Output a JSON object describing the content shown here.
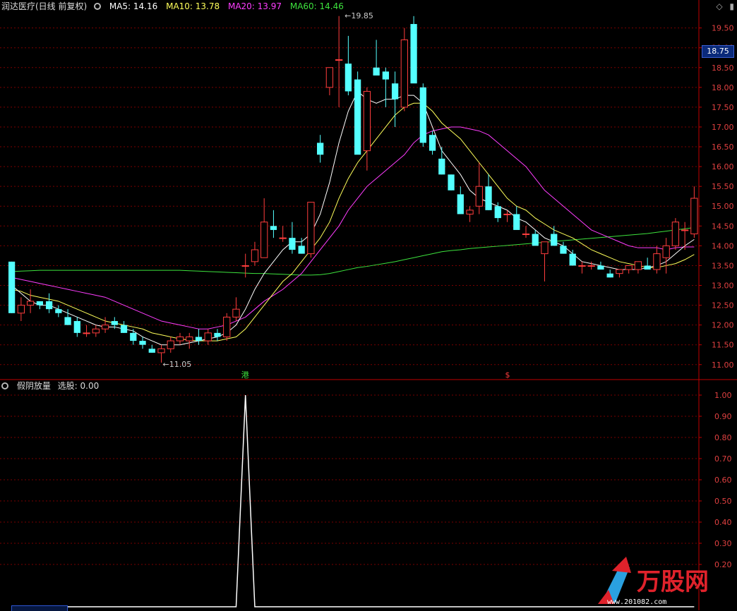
{
  "header_top": {
    "title": "润达医疗(日线 前复权)",
    "ma5": "MA5: 14.16",
    "ma10": "MA10: 13.78",
    "ma20": "MA20: 13.97",
    "ma60": "MA60: 14.46"
  },
  "header_bottom": {
    "title": "假阴放量",
    "value": "选股: 0.00"
  },
  "current_price_tag": "18.75",
  "annotations": {
    "high": "19.85",
    "low": "11.05",
    "marker_a": "港",
    "marker_b": "$"
  },
  "watermark": {
    "brand": "万股网",
    "url": "www.201082.com"
  },
  "colors": {
    "up": "#ff3d3d",
    "down": "#54ffff",
    "ma5": "#ffffff",
    "ma10": "#ffff5a",
    "ma20": "#ff3dff",
    "ma60": "#3de23d",
    "grid": "#7a0000",
    "axis": "#c00000"
  },
  "chart_data": [
    {
      "type": "candlestick",
      "title": "润达医疗(日线 前复权)",
      "ylim": [
        10.8,
        19.85
      ],
      "yticks": [
        "11.00",
        "11.50",
        "12.00",
        "12.50",
        "13.00",
        "13.50",
        "14.00",
        "14.50",
        "15.00",
        "15.50",
        "16.00",
        "16.50",
        "17.00",
        "17.50",
        "18.00",
        "18.50",
        "19.00",
        "19.50"
      ],
      "candles": [
        [
          13.6,
          13.6,
          12.3,
          12.3
        ],
        [
          12.3,
          12.7,
          12.1,
          12.5
        ],
        [
          12.5,
          12.9,
          12.3,
          12.6
        ],
        [
          12.6,
          12.6,
          12.4,
          12.5
        ],
        [
          12.6,
          12.8,
          12.3,
          12.4
        ],
        [
          12.4,
          12.5,
          12.2,
          12.3
        ],
        [
          12.2,
          12.4,
          12.0,
          12.0
        ],
        [
          12.1,
          12.2,
          11.7,
          11.8
        ],
        [
          11.8,
          12.0,
          11.7,
          11.8
        ],
        [
          11.8,
          12.0,
          11.7,
          11.9
        ],
        [
          11.9,
          12.2,
          11.8,
          12.0
        ],
        [
          12.1,
          12.2,
          11.9,
          12.0
        ],
        [
          12.0,
          12.1,
          11.8,
          11.8
        ],
        [
          11.8,
          11.9,
          11.5,
          11.6
        ],
        [
          11.6,
          11.7,
          11.4,
          11.5
        ],
        [
          11.4,
          11.5,
          11.3,
          11.3
        ],
        [
          11.3,
          11.5,
          11.05,
          11.4
        ],
        [
          11.4,
          11.7,
          11.3,
          11.6
        ],
        [
          11.6,
          11.8,
          11.5,
          11.7
        ],
        [
          11.6,
          11.8,
          11.4,
          11.7
        ],
        [
          11.7,
          11.9,
          11.5,
          11.6
        ],
        [
          11.6,
          11.9,
          11.5,
          11.8
        ],
        [
          11.8,
          11.9,
          11.6,
          11.7
        ],
        [
          11.7,
          12.3,
          11.6,
          12.2
        ],
        [
          12.2,
          12.7,
          12.1,
          12.4
        ],
        [
          13.5,
          13.8,
          13.2,
          13.5
        ],
        [
          13.6,
          14.1,
          13.5,
          13.9
        ],
        [
          13.7,
          15.2,
          13.7,
          14.6
        ],
        [
          14.5,
          14.9,
          14.2,
          14.4
        ],
        [
          14.2,
          14.5,
          14.1,
          14.2
        ],
        [
          14.2,
          14.6,
          13.8,
          13.9
        ],
        [
          14.0,
          14.2,
          13.8,
          13.8
        ],
        [
          13.8,
          15.0,
          13.7,
          15.1
        ],
        [
          16.6,
          16.8,
          16.1,
          16.3
        ],
        [
          18.0,
          18.5,
          17.8,
          18.5
        ],
        [
          18.7,
          19.8,
          17.5,
          18.7
        ],
        [
          18.6,
          19.3,
          17.8,
          17.9
        ],
        [
          18.2,
          18.4,
          16.8,
          16.3
        ],
        [
          16.4,
          18.0,
          15.9,
          17.9
        ],
        [
          18.5,
          19.2,
          18.3,
          18.3
        ],
        [
          18.4,
          18.5,
          17.5,
          18.2
        ],
        [
          18.1,
          18.4,
          17.0,
          17.7
        ],
        [
          17.5,
          19.5,
          17.4,
          19.2
        ],
        [
          19.6,
          19.8,
          18.2,
          18.1
        ],
        [
          18.0,
          18.1,
          16.5,
          16.6
        ],
        [
          16.8,
          16.9,
          16.3,
          16.4
        ],
        [
          16.2,
          16.5,
          15.8,
          15.8
        ],
        [
          15.8,
          15.8,
          15.4,
          15.4
        ],
        [
          15.3,
          15.5,
          14.8,
          14.8
        ],
        [
          14.8,
          15.0,
          14.6,
          14.9
        ],
        [
          15.0,
          16.1,
          14.8,
          15.5
        ],
        [
          15.5,
          15.8,
          14.9,
          14.9
        ],
        [
          15.0,
          15.1,
          14.6,
          14.7
        ],
        [
          14.8,
          14.9,
          14.6,
          14.8
        ],
        [
          14.8,
          15.0,
          14.5,
          14.4
        ],
        [
          14.3,
          14.5,
          14.2,
          14.3
        ],
        [
          14.3,
          14.4,
          14.0,
          14.0
        ],
        [
          13.8,
          14.1,
          13.1,
          14.1
        ],
        [
          14.3,
          14.5,
          14.0,
          14.0
        ],
        [
          14.0,
          14.1,
          13.8,
          13.8
        ],
        [
          13.8,
          13.9,
          13.6,
          13.5
        ],
        [
          13.5,
          13.6,
          13.3,
          13.5
        ],
        [
          13.5,
          13.6,
          13.4,
          13.5
        ],
        [
          13.5,
          13.6,
          13.4,
          13.4
        ],
        [
          13.3,
          13.4,
          13.2,
          13.2
        ],
        [
          13.3,
          13.4,
          13.2,
          13.4
        ],
        [
          13.4,
          13.5,
          13.3,
          13.5
        ],
        [
          13.4,
          13.6,
          13.3,
          13.6
        ],
        [
          13.5,
          13.7,
          13.4,
          13.4
        ],
        [
          13.4,
          14.0,
          13.3,
          13.8
        ],
        [
          13.7,
          14.2,
          13.3,
          14.0
        ],
        [
          14.0,
          14.7,
          13.9,
          14.6
        ],
        [
          14.4,
          14.6,
          13.9,
          14.4
        ],
        [
          14.3,
          15.5,
          14.2,
          15.2
        ]
      ],
      "ma5": [
        13.0,
        12.8,
        12.6,
        12.5,
        12.5,
        12.4,
        12.3,
        12.2,
        12.1,
        12.0,
        11.95,
        11.95,
        11.9,
        11.85,
        11.7,
        11.6,
        11.5,
        11.5,
        11.5,
        11.55,
        11.6,
        11.65,
        11.7,
        11.8,
        12.0,
        12.4,
        12.9,
        13.3,
        13.6,
        13.9,
        14.1,
        14.1,
        14.3,
        14.8,
        15.6,
        16.6,
        17.4,
        17.9,
        17.7,
        17.6,
        17.7,
        17.7,
        17.8,
        17.8,
        17.6,
        17.0,
        16.4,
        16.1,
        15.8,
        15.4,
        15.2,
        15.1,
        15.0,
        14.9,
        14.7,
        14.6,
        14.4,
        14.2,
        14.1,
        14.0,
        13.8,
        13.6,
        13.55,
        13.5,
        13.45,
        13.4,
        13.4,
        13.4,
        13.45,
        13.5,
        13.6,
        13.8,
        14.0,
        14.16
      ],
      "ma10": [
        12.9,
        12.85,
        12.75,
        12.7,
        12.65,
        12.6,
        12.5,
        12.4,
        12.3,
        12.2,
        12.1,
        12.05,
        12.0,
        11.95,
        11.9,
        11.8,
        11.75,
        11.7,
        11.65,
        11.62,
        11.6,
        11.6,
        11.6,
        11.65,
        11.7,
        11.9,
        12.2,
        12.5,
        12.8,
        13.1,
        13.3,
        13.6,
        13.9,
        14.2,
        14.6,
        15.2,
        15.7,
        16.1,
        16.4,
        16.7,
        17.0,
        17.3,
        17.5,
        17.6,
        17.6,
        17.4,
        17.1,
        16.9,
        16.7,
        16.4,
        16.1,
        15.8,
        15.5,
        15.2,
        15.0,
        14.9,
        14.7,
        14.55,
        14.4,
        14.3,
        14.2,
        14.05,
        13.9,
        13.8,
        13.7,
        13.6,
        13.55,
        13.5,
        13.45,
        13.45,
        13.5,
        13.55,
        13.65,
        13.78
      ],
      "ma20": [
        13.2,
        13.15,
        13.1,
        13.05,
        13.0,
        12.95,
        12.9,
        12.85,
        12.8,
        12.75,
        12.7,
        12.6,
        12.5,
        12.4,
        12.3,
        12.2,
        12.1,
        12.05,
        12.0,
        11.95,
        11.9,
        11.9,
        11.95,
        12.0,
        12.1,
        12.2,
        12.4,
        12.6,
        12.75,
        12.9,
        13.1,
        13.3,
        13.6,
        13.9,
        14.2,
        14.5,
        14.9,
        15.2,
        15.5,
        15.7,
        15.9,
        16.1,
        16.3,
        16.6,
        16.8,
        16.9,
        16.95,
        17.0,
        17.0,
        16.95,
        16.9,
        16.8,
        16.6,
        16.4,
        16.2,
        16.0,
        15.7,
        15.4,
        15.2,
        15.0,
        14.8,
        14.6,
        14.4,
        14.3,
        14.2,
        14.1,
        14.0,
        13.95,
        13.95,
        13.95,
        13.9,
        13.95,
        13.97,
        13.97
      ],
      "ma60": [
        13.35,
        13.36,
        13.37,
        13.38,
        13.38,
        13.38,
        13.38,
        13.38,
        13.38,
        13.38,
        13.38,
        13.38,
        13.38,
        13.38,
        13.38,
        13.38,
        13.38,
        13.38,
        13.38,
        13.37,
        13.36,
        13.35,
        13.34,
        13.33,
        13.32,
        13.31,
        13.3,
        13.3,
        13.29,
        13.28,
        13.27,
        13.26,
        13.26,
        13.27,
        13.3,
        13.35,
        13.4,
        13.45,
        13.48,
        13.52,
        13.56,
        13.6,
        13.65,
        13.7,
        13.75,
        13.8,
        13.85,
        13.88,
        13.9,
        13.93,
        13.95,
        13.97,
        13.99,
        14.01,
        14.03,
        14.05,
        14.07,
        14.09,
        14.11,
        14.13,
        14.15,
        14.17,
        14.19,
        14.21,
        14.23,
        14.25,
        14.27,
        14.29,
        14.31,
        14.34,
        14.37,
        14.4,
        14.43,
        14.46
      ]
    },
    {
      "type": "line",
      "title": "假阴放量",
      "ylim": [
        0.0,
        1.0
      ],
      "yticks": [
        "0.20",
        "0.30",
        "0.40",
        "0.50",
        "0.60",
        "0.70",
        "0.80",
        "0.90",
        "1.00"
      ],
      "values": [
        0,
        0,
        0,
        0,
        0,
        0,
        0,
        0,
        0,
        0,
        0,
        0,
        0,
        0,
        0,
        0,
        0,
        0,
        0,
        0,
        0,
        0,
        0,
        0,
        0,
        0,
        0,
        0,
        0,
        0,
        0,
        0,
        0,
        0,
        0,
        0,
        0,
        0,
        0,
        0,
        0,
        0,
        0,
        0,
        0,
        0,
        0,
        0,
        0,
        0,
        0,
        0,
        0,
        0,
        0,
        0,
        0,
        0,
        0,
        0,
        0,
        0,
        0,
        0,
        0,
        0,
        0,
        0,
        0,
        0,
        0,
        0,
        0,
        0
      ]
    }
  ]
}
